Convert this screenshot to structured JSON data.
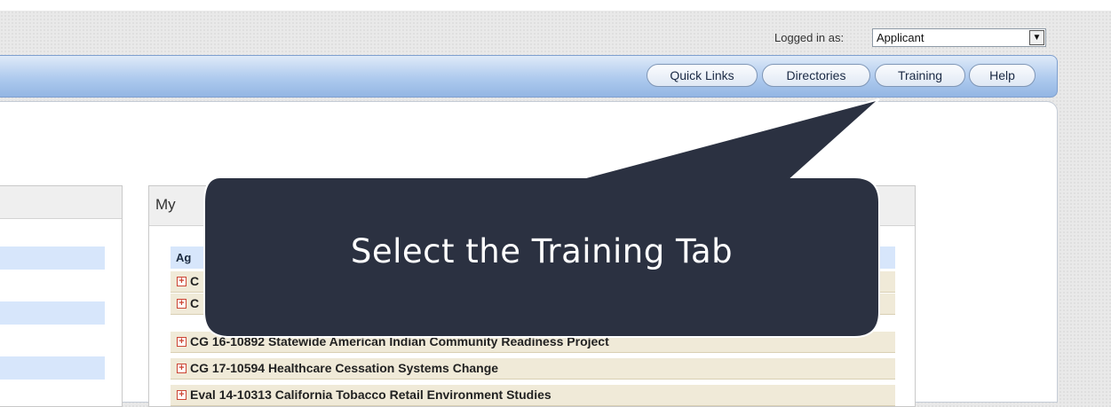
{
  "header": {
    "login_label": "Logged in as:",
    "role": {
      "selected": "Applicant"
    }
  },
  "nav": {
    "tabs": [
      {
        "label": "Quick Links"
      },
      {
        "label": "Directories"
      },
      {
        "label": "Training"
      },
      {
        "label": "Help"
      }
    ]
  },
  "panel": {
    "title": "My",
    "table_header": "Ag",
    "rows": [
      {
        "label": "C"
      },
      {
        "label": "C"
      },
      {
        "label": "CG 16-10892 Statewide American Indian Community Readiness Project"
      },
      {
        "label": "CG 17-10594 Healthcare Cessation Systems Change"
      },
      {
        "label": "Eval 14-10313 California Tobacco Retail Environment Studies"
      }
    ]
  },
  "callout": {
    "text": "Select the Training Tab",
    "fill_color": "#2b3141",
    "border_color": "#ffffff"
  },
  "icons": {
    "expand": "plus-square-icon",
    "dropdown": "chevron-down-icon"
  }
}
